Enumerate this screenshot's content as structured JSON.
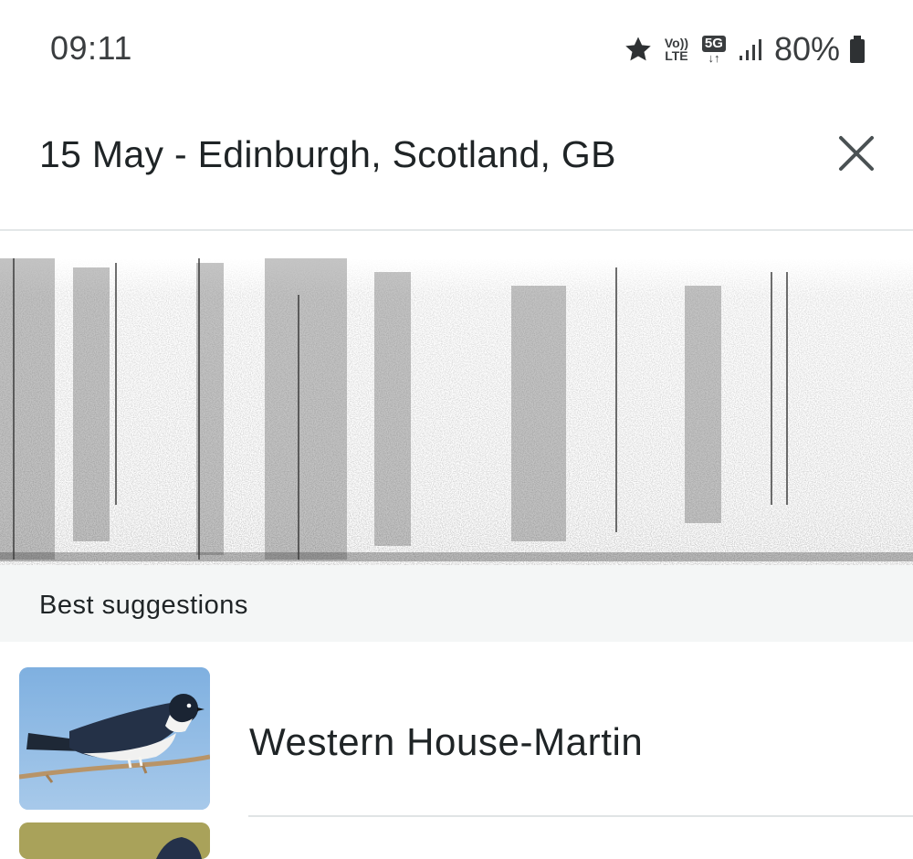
{
  "status_bar": {
    "time": "09:11",
    "volte_top": "Vo))",
    "volte_bottom": "LTE",
    "network": "5G",
    "network_arrows": "↓↑",
    "battery": "80%"
  },
  "header": {
    "title": "15 May - Edinburgh, Scotland, GB",
    "close_icon": "close-icon"
  },
  "spectrogram": {
    "tone": "#6f6f6f"
  },
  "suggestions": {
    "section_title": "Best suggestions",
    "items": [
      {
        "name": "Western House-Martin",
        "image": "house-martin-photo"
      }
    ]
  },
  "colors": {
    "text": "#1f2426",
    "section_bg": "#f4f6f6",
    "divider": "#e3e7e8"
  }
}
